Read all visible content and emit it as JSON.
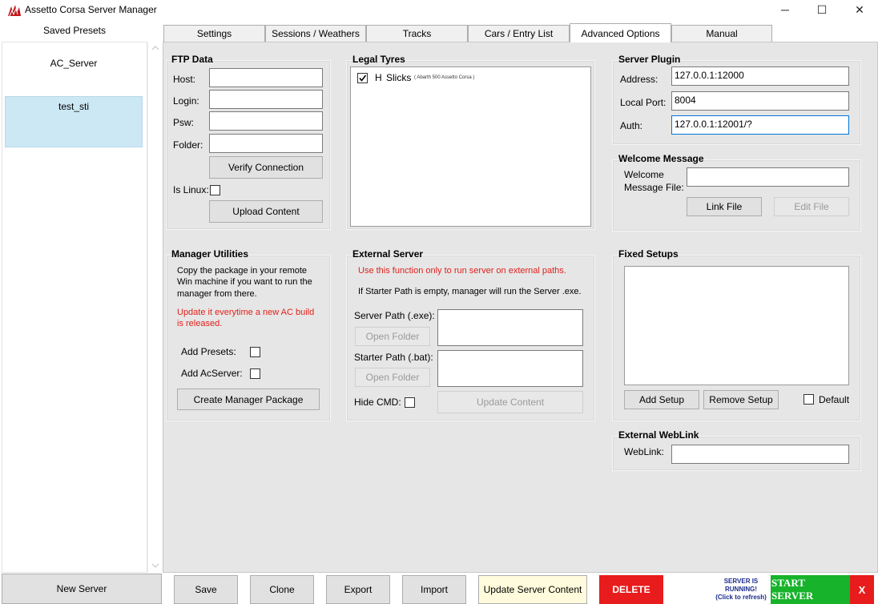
{
  "window": {
    "title": "Assetto Corsa Server Manager",
    "minimize": "─",
    "maximize": "☐",
    "close": "✕"
  },
  "sidebar": {
    "label": "Saved Presets",
    "presets": [
      "AC_Server",
      "test_sti"
    ],
    "new_server": "New Server"
  },
  "tabs": [
    {
      "label": "Settings"
    },
    {
      "label": "Sessions / Weathers"
    },
    {
      "label": "Tracks"
    },
    {
      "label": "Cars / Entry List"
    },
    {
      "label": "Advanced Options"
    },
    {
      "label": "Manual"
    }
  ],
  "ftp": {
    "title": "FTP Data",
    "host_label": "Host:",
    "login_label": "Login:",
    "psw_label": "Psw:",
    "folder_label": "Folder:",
    "host_value": "",
    "login_value": "",
    "psw_value": "",
    "folder_value": "",
    "verify": "Verify Connection",
    "islinux_label": "Is Linux:",
    "upload": "Upload Content"
  },
  "tyres": {
    "title": "Legal Tyres",
    "items": [
      {
        "code": "H",
        "name": "Slicks",
        "car": "( Abarth 500 Assetto Corsa )",
        "checked": true
      }
    ]
  },
  "plugin": {
    "title": "Server Plugin",
    "address_label": "Address:",
    "address_value": "127.0.0.1:12000",
    "localport_label": "Local Port:",
    "localport_value": "8004",
    "auth_label": "Auth:",
    "auth_value": "127.0.0.1:12001/?"
  },
  "welcome": {
    "title": "Welcome Message",
    "label_line1": "Welcome",
    "label_line2": "Message File:",
    "value": "",
    "link": "Link File",
    "edit": "Edit File"
  },
  "utilities": {
    "title": "Manager Utilities",
    "desc_line1": "Copy the package in your remote",
    "desc_line2": "Win machine if you want to run the",
    "desc_line3": "manager from there.",
    "warn_line1": "Update it everytime a new AC build",
    "warn_line2": "is released.",
    "add_presets": "Add Presets:",
    "add_acserver": "Add AcServer:",
    "create": "Create Manager Package"
  },
  "external": {
    "title": "External Server",
    "warn": "Use this function only to run server on external paths.",
    "info": "If Starter Path is empty, manager will run the Server .exe.",
    "server_path": "Server Path (.exe):",
    "starter_path": "Starter Path (.bat):",
    "open_folder_1": "Open Folder",
    "open_folder_2": "Open Folder",
    "hide_cmd": "Hide CMD:",
    "update": "Update Content"
  },
  "fixed": {
    "title": "Fixed Setups",
    "add": "Add Setup",
    "remove": "Remove Setup",
    "default": "Default"
  },
  "weblink": {
    "title": "External WebLink",
    "label": "WebLink:",
    "value": ""
  },
  "bottom": {
    "save": "Save",
    "clone": "Clone",
    "export": "Export",
    "import": "Import",
    "update": "Update Server Content",
    "delete": "DELETE",
    "status_line1": "SERVER IS",
    "status_line2": "RUNNING!",
    "status_line3": "(Click to refresh)",
    "start": "START SERVER",
    "stop": "X"
  },
  "colors": {
    "delete_bg": "#e81c1c",
    "start_bg": "#17b32a",
    "stop_bg": "#e81c1c",
    "update_bg": "#fffbdc",
    "status_text": "#1a2b8c",
    "selected_preset": "#cce8f4"
  }
}
